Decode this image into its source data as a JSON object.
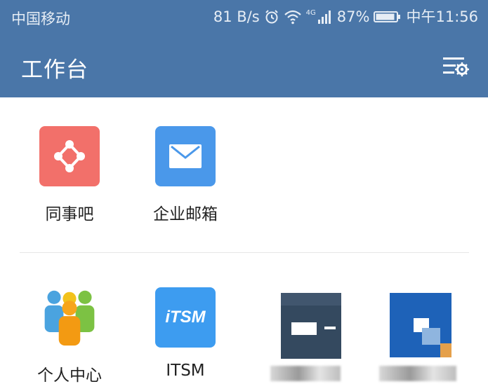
{
  "status_bar": {
    "carrier": "中国移动",
    "speed": "81 B/s",
    "network": "4G",
    "battery": "87%",
    "time": "中午11:56"
  },
  "header": {
    "title": "工作台"
  },
  "apps_row1": [
    {
      "label": "同事吧",
      "icon": "colleague-hub-icon",
      "color": "#f2706a"
    },
    {
      "label": "企业邮箱",
      "icon": "mail-icon",
      "color": "#4a98ea"
    }
  ],
  "apps_row2": [
    {
      "label": "个人中心",
      "icon": "people-group-icon"
    },
    {
      "label": "ITSM",
      "icon_text": "iTSM",
      "color": "#3d9cf0"
    },
    {
      "label": "",
      "icon": "obscured-app-icon"
    },
    {
      "label": "",
      "icon": "obscured-app-icon"
    }
  ],
  "colors": {
    "header_bg": "#4a76a8",
    "divider": "#e6e6e6"
  }
}
